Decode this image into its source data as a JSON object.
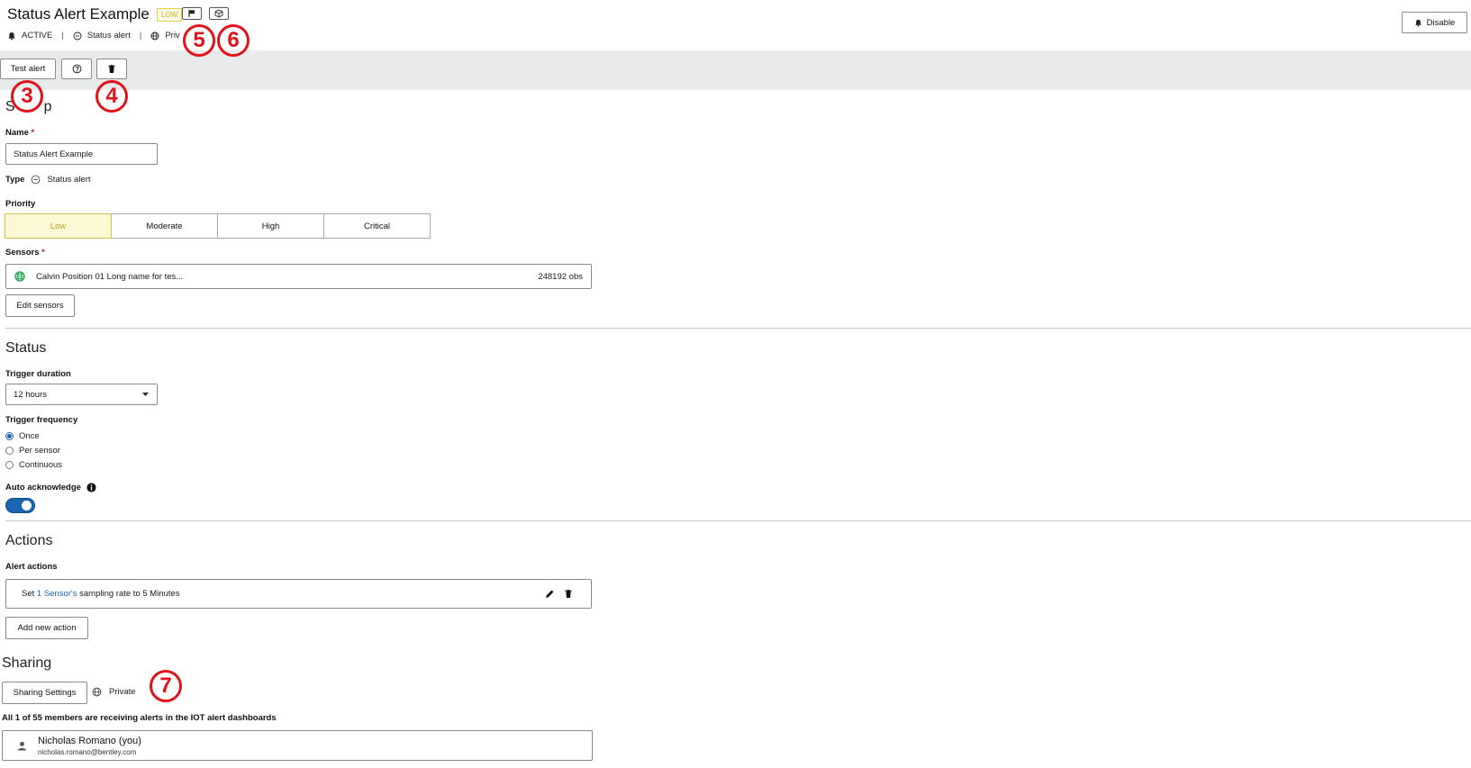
{
  "header": {
    "title": "Status Alert Example",
    "priority_badge": "LOW",
    "status": "ACTIVE",
    "type": "Status alert",
    "visibility": "Priv",
    "disable_label": "Disable"
  },
  "toolbar": {
    "test_alert_label": "Test alert"
  },
  "callouts": [
    "5",
    "6",
    "3",
    "4",
    "7"
  ],
  "setup": {
    "title_visible": "S",
    "title_tail": "p",
    "name_label": "Name",
    "required_mark": "*",
    "name_value": "Status Alert Example",
    "type_label": "Type",
    "type_value": "Status alert",
    "priority_label": "Priority",
    "priority_options": [
      "Low",
      "Moderate",
      "High",
      "Critical"
    ],
    "priority_selected": "Low",
    "sensors_label": "Sensors",
    "sensor_name": "Calvin Position 01 Long name for tes...",
    "sensor_obs": "248192 obs",
    "edit_sensors_label": "Edit sensors"
  },
  "status": {
    "title": "Status",
    "trigger_duration_label": "Trigger duration",
    "trigger_duration_value": "12 hours",
    "trigger_frequency_label": "Trigger frequency",
    "frequency_options": [
      "Once",
      "Per sensor",
      "Continuous"
    ],
    "frequency_selected": "Once",
    "auto_ack_label": "Auto acknowledge",
    "auto_ack_on": true
  },
  "actions": {
    "title": "Actions",
    "alert_actions_label": "Alert actions",
    "action_prefix": "Set",
    "action_link": "1 Sensor's",
    "action_suffix": "sampling rate to 5 Minutes",
    "add_action_label": "Add new action"
  },
  "sharing": {
    "title": "Sharing",
    "settings_label": "Sharing Settings",
    "visibility": "Private",
    "members_note": "All 1 of 55 members are receiving alerts in the IOT alert dashboards",
    "member_name": "Nicholas Romano (you)",
    "member_email": "nicholas.romano@bentley.com"
  },
  "colors": {
    "accent": "#1b65b0",
    "callout": "#e0121a",
    "low": "#c9b21a",
    "sensor_ok": "#1fa34a"
  }
}
